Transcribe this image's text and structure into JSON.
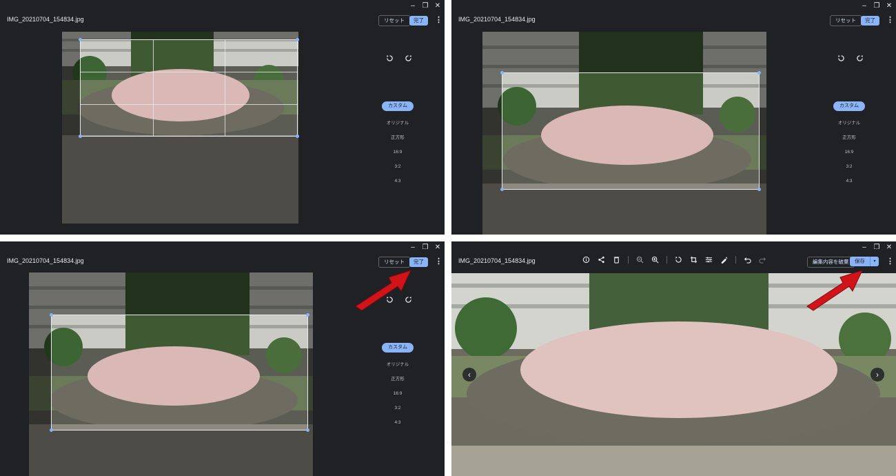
{
  "file_name": "IMG_20210704_154834.jpg",
  "window_controls": {
    "minimize": "–",
    "restore": "❐",
    "close": "✕"
  },
  "crop_editor": {
    "reset_label": "リセット",
    "done_label": "完了",
    "aspect_options": [
      "カスタム",
      "オリジナル",
      "正方形",
      "16:9",
      "3:2",
      "4:3"
    ],
    "selected_aspect": "カスタム"
  },
  "viewer": {
    "discard_edits_label": "編集内容を破棄",
    "save_label": "保存",
    "save_dropdown": "▾",
    "prev": "‹",
    "next": "›"
  },
  "icons": {
    "toolbar": [
      "info-icon",
      "share-icon",
      "delete-icon",
      "zoom-out-icon",
      "zoom-in-icon",
      "rotate-icon",
      "crop-icon",
      "adjust-icon",
      "annotate-icon",
      "undo-icon",
      "redo-icon"
    ],
    "side": [
      "rotate-left-icon",
      "flip-icon"
    ]
  },
  "colors": {
    "accent": "#8ab4f8",
    "background": "#202124",
    "arrow": "#d0141a"
  }
}
